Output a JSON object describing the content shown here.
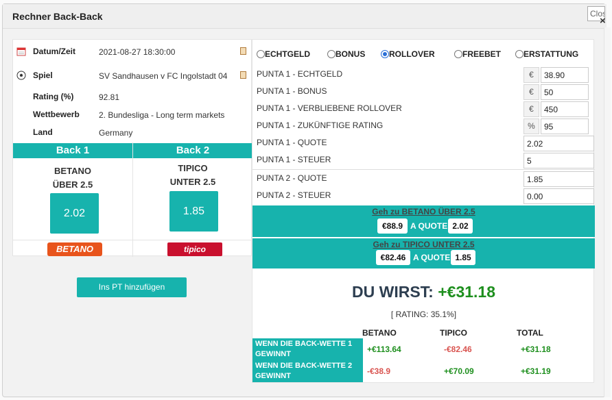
{
  "dialog": {
    "title": "Rechner Back-Back",
    "close_label": "Close",
    "close_icon": "×"
  },
  "event": {
    "date_label": "Datum/Zeit",
    "date_value": "2021-08-27 18:30:00",
    "game_label": "Spiel",
    "game_value": "SV Sandhausen v FC Ingolstadt 04",
    "rating_label": "Rating (%)",
    "rating_value": "92.81",
    "competition_label": "Wettbewerb",
    "competition_value": "2. Bundesliga - Long term markets",
    "country_label": "Land",
    "country_value": "Germany"
  },
  "back1": {
    "header": "Back 1",
    "bookmaker": "BETANO",
    "market": "ÜBER 2.5",
    "quote": "2.02",
    "logo_text": "BETANO"
  },
  "back2": {
    "header": "Back 2",
    "bookmaker": "TIPICO",
    "market": "UNTER 2.5",
    "quote": "1.85",
    "logo_text": "tipico"
  },
  "add_button_label": "Ins PT hinzufügen",
  "bet_types": [
    {
      "label": "ECHTGELD",
      "checked": false
    },
    {
      "label": "BONUS",
      "checked": false
    },
    {
      "label": "ROLLOVER",
      "checked": true
    },
    {
      "label": "FREEBET",
      "checked": false
    },
    {
      "label": "ERSTATTUNG",
      "checked": false
    }
  ],
  "params": [
    {
      "label": "PUNTA 1 - ECHTGELD",
      "unit": "€",
      "value": "38.90"
    },
    {
      "label": "PUNTA 1 - BONUS",
      "unit": "€",
      "value": "50"
    },
    {
      "label": "PUNTA 1 - VERBLIEBENE ROLLOVER",
      "unit": "€",
      "value": "450"
    },
    {
      "label": "PUNTA 1 - ZUKÜNFTIGE RATING",
      "unit": "%",
      "value": "95"
    },
    {
      "label": "PUNTA 1 - QUOTE",
      "value": "2.02"
    },
    {
      "label": "PUNTA 1 - STEUER",
      "value": "5"
    },
    {
      "label": "PUNTA 2  - QUOTE",
      "value": "1.85"
    },
    {
      "label": "PUNTA 2 - STEUER",
      "value": "0.00"
    }
  ],
  "bets": [
    {
      "link": "Geh zu BETANO ÜBER 2.5",
      "amount": "€88.9",
      "a_quote": "A QUOTE",
      "quote": "2.02"
    },
    {
      "link": "Geh zu TIPICO UNTER 2.5",
      "amount": "€82.46",
      "a_quote": "A QUOTE",
      "quote": "1.85"
    }
  ],
  "result": {
    "label": "DU WIRST:",
    "value": "+€31.18",
    "rating": "[ RATING: 35.1%]"
  },
  "outcome_table": {
    "headers": [
      "BETANO",
      "TIPICO",
      "TOTAL"
    ],
    "rows": [
      {
        "label": "WENN DIE BACK-WETTE 1 GEWINNT",
        "betano": "+€113.64",
        "tipico": "-€82.46",
        "total": "+€31.18"
      },
      {
        "label": "WENN DIE BACK-WETTE 2 GEWINNT",
        "betano": "-€38.9",
        "tipico": "+€70.09",
        "total": "+€31.19"
      }
    ]
  },
  "colors": {
    "accent": "#17b3ad",
    "positive": "#1e8f1e",
    "negative": "#d9534f",
    "radio_checked": "#2a6fd6"
  }
}
